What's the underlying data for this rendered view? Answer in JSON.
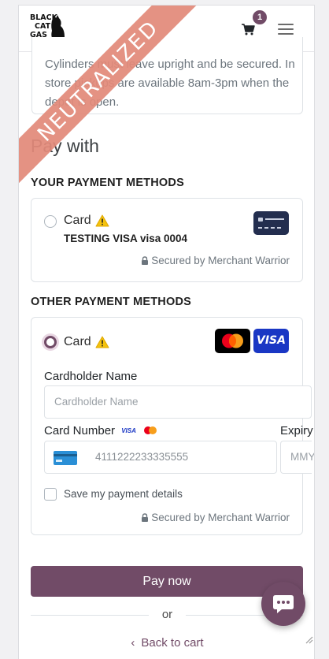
{
  "header": {
    "logo_text": [
      "BLACK",
      "CAT",
      "GAS"
    ],
    "cart_count": "1"
  },
  "ribbon": {
    "text": "NEUTRALIZED"
  },
  "note": {
    "text": "Cylinders must leave upright and be secured. In store pickups are available 8am-3pm when the depot is open."
  },
  "pay_with": {
    "title": "Pay with"
  },
  "saved_methods": {
    "title": "YOUR PAYMENT METHODS",
    "card_label": "Card",
    "card_name": "TESTING VISA visa 0004",
    "secured": "Secured by Merchant Warrior"
  },
  "other_methods": {
    "title": "OTHER PAYMENT METHODS",
    "card_label": "Card",
    "visa_brand": "VISA",
    "cardholder_label": "Cardholder Name",
    "cardholder_placeholder": "Cardholder Name",
    "card_number_label": "Card Number",
    "card_number_value": "4111222233335555",
    "card_number_visa": "VISA",
    "expiry_label": "Expiry",
    "expiry_placeholder": "MMY",
    "save_label": "Save my payment details",
    "secured": "Secured by Merchant Warrior"
  },
  "actions": {
    "pay_now": "Pay now",
    "or": "or",
    "back": "Back to cart"
  },
  "colors": {
    "primary": "#714b67",
    "ribbon": "#e28a7a",
    "warning": "#f4c20d",
    "visa_blue": "#1a37c4"
  }
}
